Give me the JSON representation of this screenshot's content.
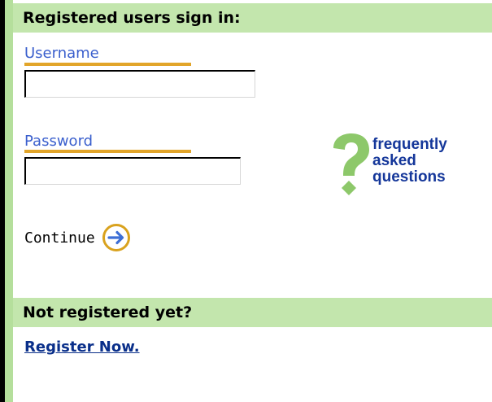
{
  "signin": {
    "heading": "Registered users sign in:",
    "username": {
      "label": "Username",
      "value": "",
      "placeholder": ""
    },
    "password": {
      "label": "Password",
      "value": "",
      "placeholder": ""
    },
    "continue_label": "Continue",
    "continue_icon": "arrow-right-circle-icon"
  },
  "faq": {
    "icon": "question-mark-icon",
    "line1": "frequently",
    "line2": "asked",
    "line3": "questions"
  },
  "register": {
    "heading": "Not registered yet?",
    "link_label": "Register Now."
  },
  "colors": {
    "section_bar": "#c3e6ad",
    "left_stripe": "#b5df9c",
    "label_blue": "#3a5fcd",
    "underline_gold": "#e2a52a",
    "faq_green": "#8dc86a",
    "faq_text": "#15379a",
    "link_blue": "#0a2f8a"
  }
}
